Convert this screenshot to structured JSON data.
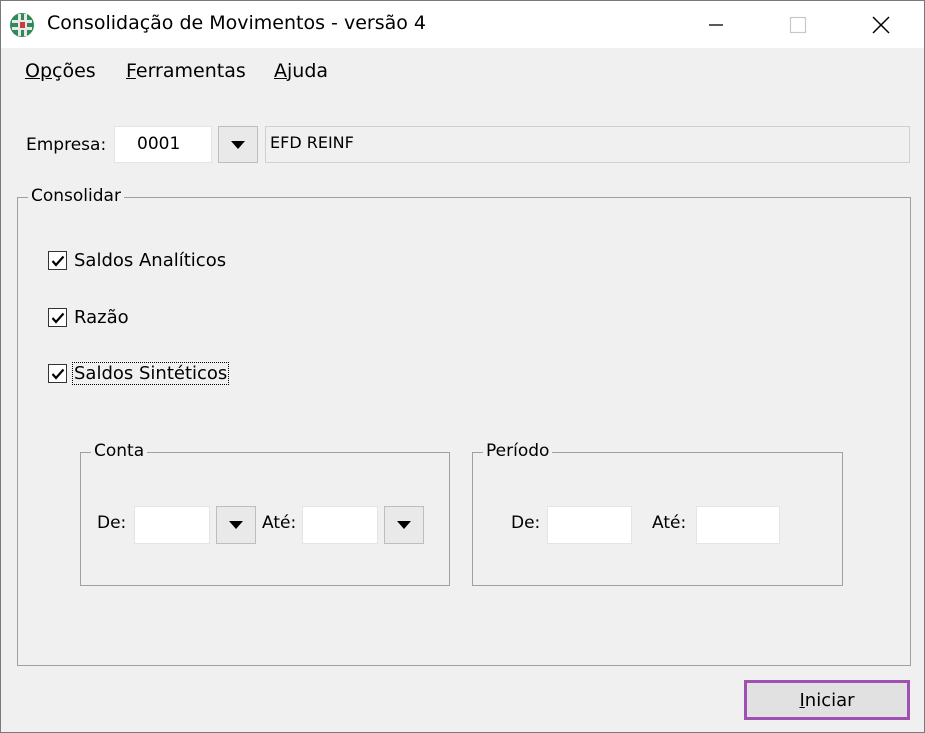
{
  "window": {
    "title": "Consolidação de Movimentos - versão 4"
  },
  "menu": {
    "opcoes_pre": "O",
    "opcoes_u": "p",
    "opcoes_post": "ções",
    "ferramentas_u": "F",
    "ferramentas_post": "erramentas",
    "ajuda_u": "A",
    "ajuda_post": "juda"
  },
  "empresa": {
    "label": "Empresa:",
    "code": "0001",
    "name": "EFD REINF"
  },
  "consolidar": {
    "legend": "Consolidar",
    "options": [
      {
        "label": "Saldos Analíticos",
        "checked": true
      },
      {
        "label": "Razão",
        "checked": true
      },
      {
        "label": "Saldos Sintéticos",
        "checked": true
      }
    ]
  },
  "conta": {
    "legend": "Conta",
    "de_label": "De:",
    "ate_label": "Até:",
    "de_value": "",
    "ate_value": ""
  },
  "periodo": {
    "legend": "Período",
    "de_label": "De:",
    "ate_label": "Até:",
    "de_value": "",
    "ate_value": ""
  },
  "actions": {
    "start_u": "I",
    "start_post": "niciar"
  },
  "colors": {
    "highlight_border": "#a050b0"
  }
}
